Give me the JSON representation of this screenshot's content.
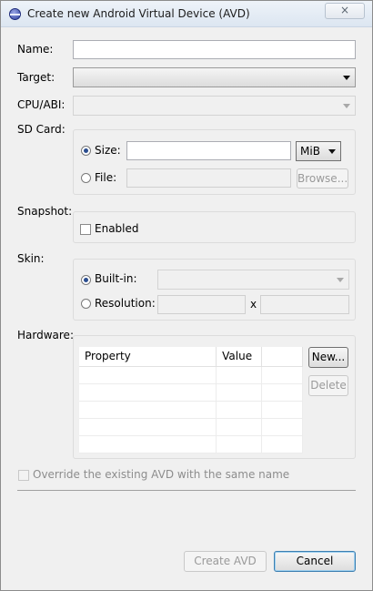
{
  "window": {
    "title": "Create new Android Virtual Device (AVD)",
    "close_glyph": "×"
  },
  "form": {
    "name_label": "Name:",
    "name_value": "",
    "target_label": "Target:",
    "target_value": "",
    "cpu_label": "CPU/ABI:",
    "cpu_value": "",
    "sdcard": {
      "label": "SD Card:",
      "size_label": "Size:",
      "size_value": "",
      "unit_value": "MiB",
      "file_label": "File:",
      "file_value": "",
      "browse_label": "Browse...",
      "selected": "size"
    },
    "snapshot": {
      "label": "Snapshot:",
      "enabled_label": "Enabled",
      "enabled": false
    },
    "skin": {
      "label": "Skin:",
      "builtin_label": "Built-in:",
      "builtin_value": "",
      "resolution_label": "Resolution:",
      "res_width": "",
      "res_height": "",
      "x_separator": "x",
      "selected": "builtin"
    },
    "hardware": {
      "label": "Hardware:",
      "columns": [
        "Property",
        "Value"
      ],
      "rows": [],
      "new_label": "New...",
      "delete_label": "Delete"
    },
    "override_label": "Override the existing AVD with the same name",
    "override_checked": false
  },
  "footer": {
    "create_label": "Create AVD",
    "cancel_label": "Cancel"
  },
  "colors": {
    "radio_dot": "#2a4d8f",
    "default_button_border": "#3c7fb1"
  }
}
